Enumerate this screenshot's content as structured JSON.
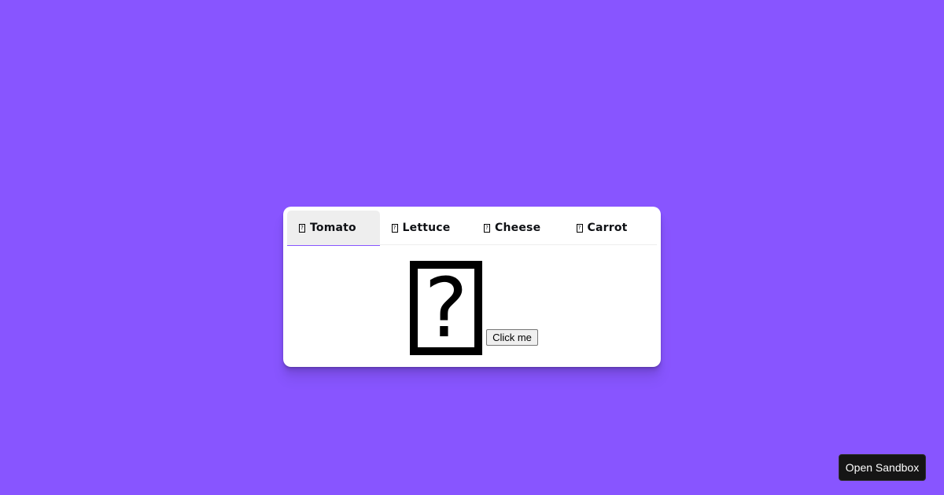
{
  "tabs": [
    {
      "icon": "missing-glyph-icon",
      "label": "Tomato",
      "selected": true
    },
    {
      "icon": "missing-glyph-icon",
      "label": "Lettuce",
      "selected": false
    },
    {
      "icon": "missing-glyph-icon",
      "label": "Cheese",
      "selected": false
    },
    {
      "icon": "missing-glyph-icon",
      "label": "Carrot",
      "selected": false
    }
  ],
  "main": {
    "glyph": "?",
    "button_label": "Click me"
  },
  "footer": {
    "sandbox_label": "Open Sandbox"
  },
  "colors": {
    "background": "#8855ff",
    "accent": "#8855ff",
    "selected_tab": "#eeeeee"
  }
}
